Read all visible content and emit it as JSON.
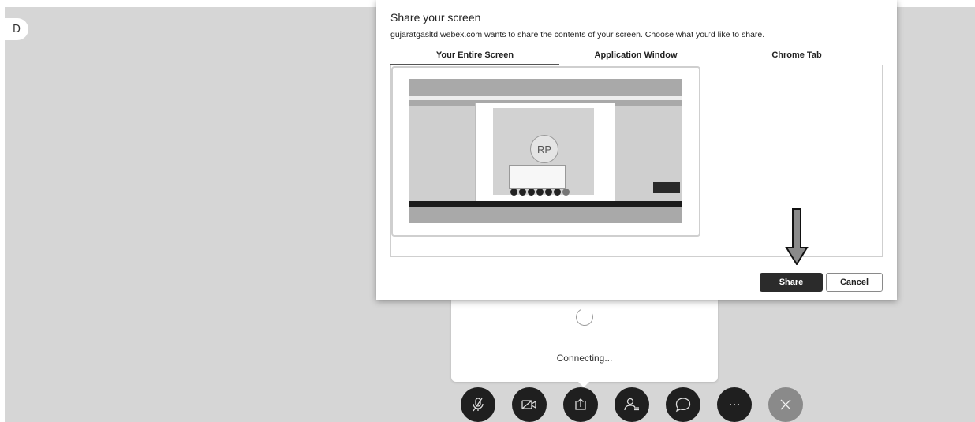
{
  "corner_badge": {
    "glyph": "D"
  },
  "dialog": {
    "title": "Share your screen",
    "subtitle": "gujaratgasltd.webex.com wants to share the contents of your screen. Choose what you'd like to share.",
    "tabs": [
      {
        "label": "Your Entire Screen",
        "active": true
      },
      {
        "label": "Application Window",
        "active": false
      },
      {
        "label": "Chrome Tab",
        "active": false
      }
    ],
    "preview_avatar": "RP",
    "share_label": "Share",
    "cancel_label": "Cancel"
  },
  "connecting": {
    "status": "Connecting..."
  },
  "toolbar": {
    "buttons": [
      {
        "icon": "microphone-muted-icon"
      },
      {
        "icon": "camera-off-icon"
      },
      {
        "icon": "share-screen-icon"
      },
      {
        "icon": "participants-icon"
      },
      {
        "icon": "chat-icon"
      },
      {
        "icon": "more-icon"
      },
      {
        "icon": "close-icon"
      }
    ]
  },
  "colors": {
    "stage": "#d6d6d6",
    "toolbar_button": "#1f1f1f",
    "end_button": "#8a8a8a",
    "share_button": "#2b2b2b"
  }
}
